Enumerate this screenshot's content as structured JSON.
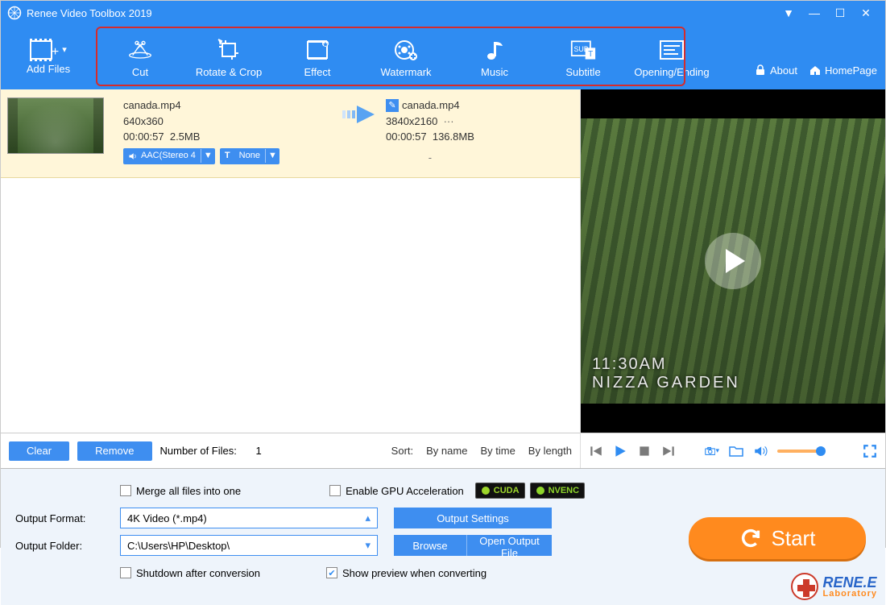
{
  "title": "Renee Video Toolbox 2019",
  "titlebar_icons": {
    "dropdown": "▼",
    "min": "—",
    "max": "☐",
    "close": "✕"
  },
  "toolbar": {
    "addfiles": "Add Files",
    "items": [
      {
        "label": "Cut"
      },
      {
        "label": "Rotate & Crop"
      },
      {
        "label": "Effect"
      },
      {
        "label": "Watermark"
      },
      {
        "label": "Music"
      },
      {
        "label": "Subtitle"
      },
      {
        "label": "Opening/Ending"
      }
    ],
    "about": "About",
    "homepage": "HomePage"
  },
  "file": {
    "src": {
      "name": "canada.mp4",
      "res": "640x360",
      "dur": "00:00:57",
      "size": "2.5MB"
    },
    "dst": {
      "name": "canada.mp4",
      "res": "3840x2160",
      "res_more": "···",
      "dur": "00:00:57",
      "size": "136.8MB"
    },
    "audio_tag": "AAC(Stereo 4",
    "subtitle_tag": "None",
    "dash": "-"
  },
  "listfooter": {
    "clear": "Clear",
    "remove": "Remove",
    "count_label": "Number of Files:",
    "count": "1",
    "sort": "Sort:",
    "byname": "By name",
    "bytime": "By time",
    "bylength": "By length"
  },
  "overlay": {
    "time": "11:30AM",
    "place": "NIZZA GARDEN"
  },
  "bottom": {
    "merge": "Merge all files into one",
    "gpu": "Enable GPU Acceleration",
    "cuda": "CUDA",
    "nvenc": "NVENC",
    "outfmt_label": "Output Format:",
    "outfmt_value": "4K Video (*.mp4)",
    "outset": "Output Settings",
    "outfolder_label": "Output Folder:",
    "outfolder_value": "C:\\Users\\HP\\Desktop\\",
    "browse": "Browse",
    "openout": "Open Output File",
    "shutdown": "Shutdown after conversion",
    "preview": "Show preview when converting",
    "start": "Start"
  },
  "brand": {
    "name": "RENE.E",
    "sub": "Laboratory"
  }
}
